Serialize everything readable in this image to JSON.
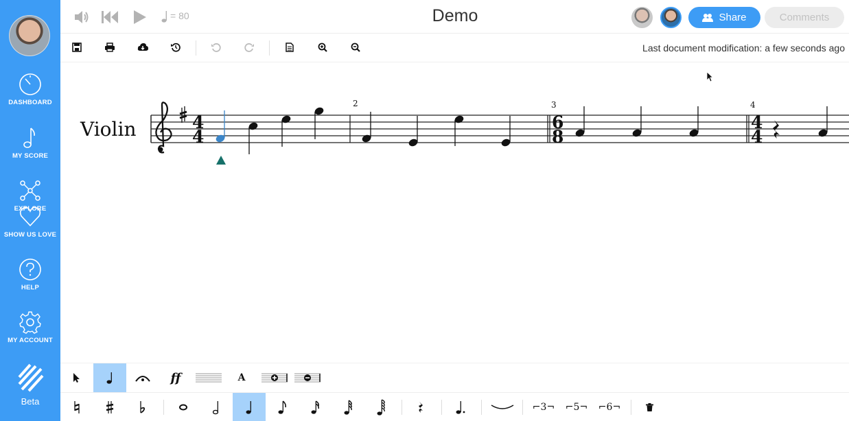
{
  "sidebar": {
    "items": [
      {
        "label": "DASHBOARD",
        "icon": "dashboard-icon"
      },
      {
        "label": "MY SCORE",
        "icon": "music-note-icon"
      },
      {
        "label": "EXPLORE",
        "icon": "network-icon"
      },
      {
        "label": "SHOW US LOVE",
        "icon": "heart-icon"
      },
      {
        "label": "HELP",
        "icon": "help-icon"
      },
      {
        "label": "MY ACCOUNT",
        "icon": "gear-icon"
      }
    ],
    "beta_label": "Beta"
  },
  "topbar": {
    "tempo_value": "80",
    "title": "Demo",
    "share_label": "Share",
    "comments_label": "Comments"
  },
  "toolbar": {
    "last_modification": "Last document modification: a few seconds ago"
  },
  "score": {
    "instrument": "Violin",
    "measure_numbers": [
      "2",
      "3",
      "4"
    ],
    "time_signatures": [
      {
        "top": "4",
        "bottom": "4"
      },
      {
        "top": "6",
        "bottom": "8"
      },
      {
        "top": "4",
        "bottom": "4"
      }
    ],
    "key_signature": "sharp",
    "selected_note_color": "#3b86c9",
    "cursor_marker_color": "#17716a"
  },
  "palette_top": {
    "active": "quarter-note",
    "text_tool_label": "A",
    "dynamics_label": "ff"
  },
  "palette_bottom": {
    "active": "quarter-note",
    "tuplets": [
      "3",
      "5",
      "6"
    ]
  },
  "colors": {
    "accent": "#3d9cf5",
    "active_tool": "#a6d2fb"
  }
}
